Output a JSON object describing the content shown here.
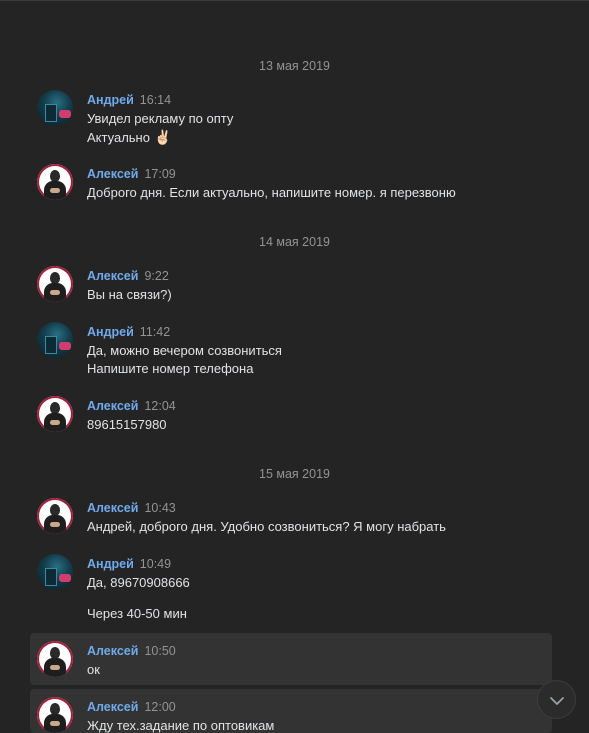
{
  "dates": [
    "13 мая 2019",
    "14 мая 2019",
    "15 мая 2019"
  ],
  "messages": [
    {
      "author": "Андрей",
      "time": "16:14",
      "lines": [
        "Увидел рекламу по опту",
        "Актуально"
      ],
      "emoji": "✌🏻"
    },
    {
      "author": "Алексей",
      "time": "17:09",
      "lines": [
        "Доброго дня. Если актуально, напишите номер. я перезвоню"
      ]
    },
    {
      "author": "Алексей",
      "time": "9:22",
      "lines": [
        "Вы на связи?)"
      ]
    },
    {
      "author": "Андрей",
      "time": "11:42",
      "lines": [
        "Да, можно вечером созвониться",
        "Напишите номер телефона"
      ]
    },
    {
      "author": "Алексей",
      "time": "12:04",
      "lines": [
        "89615157980"
      ]
    },
    {
      "author": "Алексей",
      "time": "10:43",
      "lines": [
        "Андрей, доброго дня. Удобно созвониться? Я могу набрать"
      ]
    },
    {
      "author": "Андрей",
      "time": "10:49",
      "lines": [
        "Да, 89670908666",
        "Через 40-50 мин"
      ]
    },
    {
      "author": "Алексей",
      "time": "10:50",
      "lines": [
        "ок"
      ]
    },
    {
      "author": "Алексей",
      "time": "12:00",
      "lines": [
        "Жду тех.задание по оптовикам"
      ]
    }
  ],
  "colors": {
    "background": "#242424",
    "author": "#71aaeb",
    "time": "#939393",
    "text": "#e1e3e6",
    "highlight": "#333333"
  },
  "icons": {
    "scroll_down": "chevron-down-icon"
  }
}
